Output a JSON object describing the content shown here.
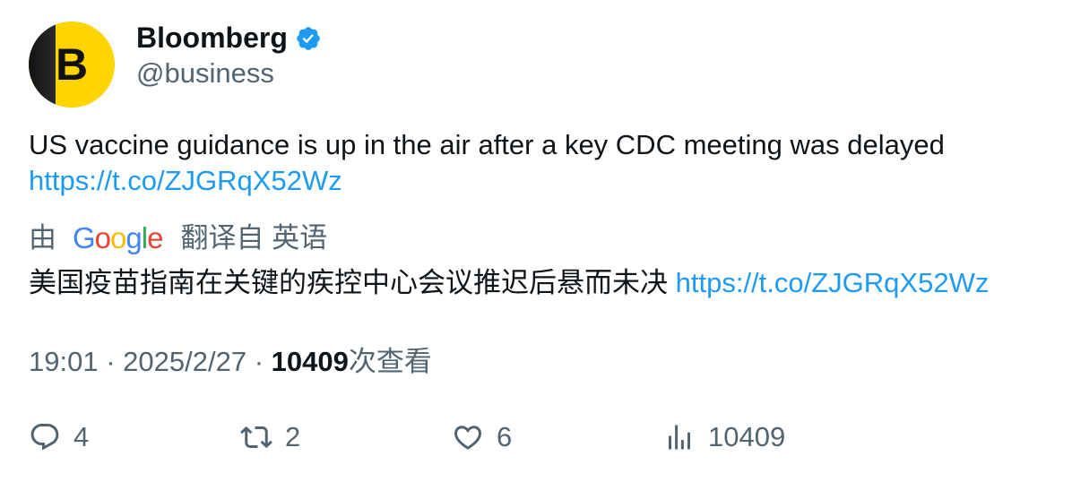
{
  "author": {
    "name": "Bloomberg",
    "handle": "@business",
    "avatar_letter": "B",
    "verified": true
  },
  "tweet": {
    "text": "US vaccine guidance is up in the air after a key CDC meeting was delayed",
    "link": "https://t.co/ZJGRqX52Wz"
  },
  "translation": {
    "prefix": "由",
    "provider": "Google",
    "suffix": "翻译自 英语",
    "text": "美国疫苗指南在关键的疾控中心会议推迟后悬而未决",
    "link": "https://t.co/ZJGRqX52Wz"
  },
  "meta": {
    "time": "19:01",
    "date": "2025/2/27",
    "separator": "·",
    "views": "10409",
    "views_label": "次查看"
  },
  "actions": {
    "replies": "4",
    "reposts": "2",
    "likes": "6",
    "views": "10409"
  },
  "colors": {
    "text": "#0f1419",
    "secondary": "#536471",
    "link": "#1d9bf0",
    "verified": "#1d9bf0",
    "avatar_bg": "#ffd400"
  }
}
